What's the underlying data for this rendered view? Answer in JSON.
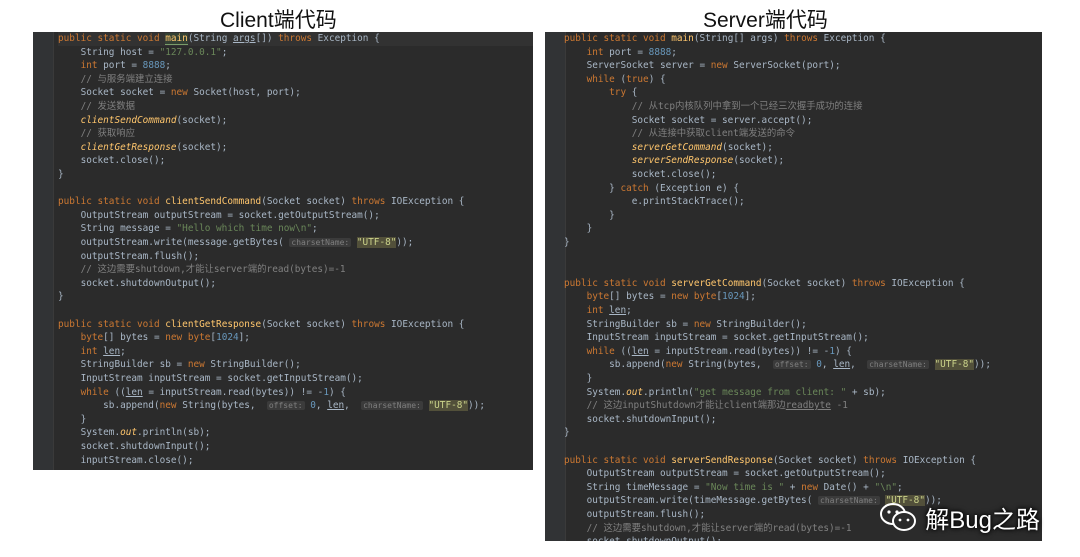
{
  "left_heading": "Client端代码",
  "right_heading": "Server端代码",
  "watermark_text": "解Bug之路",
  "colors": {
    "editor_bg": "#2b2b2b",
    "keyword": "#cc7832",
    "method": "#ffc66d",
    "string": "#6a8759",
    "number": "#6897bb",
    "comment": "#808080",
    "text": "#a9b7c6"
  },
  "client_code": [
    [
      [
        "kw",
        "public static void "
      ],
      [
        "fnm",
        "main"
      ],
      [
        "t",
        "(String "
      ],
      [
        "ul",
        "args"
      ],
      [
        "t",
        "[]) "
      ],
      [
        "kw",
        "throws "
      ],
      [
        "t",
        "Exception {"
      ]
    ],
    [
      [
        "t",
        "    String host = "
      ],
      [
        "str",
        "\"127.0.0.1\""
      ],
      [
        "t",
        ";"
      ]
    ],
    [
      [
        "kw",
        "    int "
      ],
      [
        "t",
        "port = "
      ],
      [
        "num",
        "8888"
      ],
      [
        "t",
        ";"
      ]
    ],
    [
      [
        "cm",
        "    // 与服务端建立连接"
      ]
    ],
    [
      [
        "t",
        "    Socket socket = "
      ],
      [
        "kw",
        "new "
      ],
      [
        "t",
        "Socket(host, port);"
      ]
    ],
    [
      [
        "cm",
        "    // 发送数据"
      ]
    ],
    [
      [
        "t",
        "    "
      ],
      [
        "it",
        "clientSendCommand"
      ],
      [
        "t",
        "(socket);"
      ]
    ],
    [
      [
        "cm",
        "    // 获取响应"
      ]
    ],
    [
      [
        "t",
        "    "
      ],
      [
        "it",
        "clientGetResponse"
      ],
      [
        "t",
        "(socket);"
      ]
    ],
    [
      [
        "t",
        "    socket.close();"
      ]
    ],
    [
      [
        "t",
        "}"
      ]
    ],
    [],
    [
      [
        "kw",
        "public static void "
      ],
      [
        "fn",
        "clientSendCommand"
      ],
      [
        "t",
        "(Socket socket) "
      ],
      [
        "kw",
        "throws "
      ],
      [
        "t",
        "IOException {"
      ]
    ],
    [
      [
        "t",
        "    OutputStream outputStream = socket.getOutputStream();"
      ]
    ],
    [
      [
        "t",
        "    String message = "
      ],
      [
        "str",
        "\"Hello which time now\\n\""
      ],
      [
        "t",
        ";"
      ]
    ],
    [
      [
        "t",
        "    outputStream.write(message.getBytes( "
      ],
      [
        "hint",
        "charsetName:"
      ],
      [
        "t",
        " "
      ],
      [
        "sbox",
        "\"UTF-8\""
      ],
      [
        "t",
        "));"
      ]
    ],
    [
      [
        "t",
        "    outputStream.flush();"
      ]
    ],
    [
      [
        "cm",
        "    // 这边需要shutdown,才能让server端的read(bytes)=-1"
      ]
    ],
    [
      [
        "t",
        "    socket.shutdownOutput();"
      ]
    ],
    [
      [
        "t",
        "}"
      ]
    ],
    [],
    [
      [
        "kw",
        "public static void "
      ],
      [
        "fn",
        "clientGetResponse"
      ],
      [
        "t",
        "(Socket socket) "
      ],
      [
        "kw",
        "throws "
      ],
      [
        "t",
        "IOException {"
      ]
    ],
    [
      [
        "kw",
        "    byte"
      ],
      [
        "t",
        "[] bytes = "
      ],
      [
        "kw",
        "new byte"
      ],
      [
        "t",
        "["
      ],
      [
        "num",
        "1024"
      ],
      [
        "t",
        "];"
      ]
    ],
    [
      [
        "kw",
        "    int "
      ],
      [
        "ul",
        "len"
      ],
      [
        "t",
        ";"
      ]
    ],
    [
      [
        "t",
        "    StringBuilder sb = "
      ],
      [
        "kw",
        "new "
      ],
      [
        "t",
        "StringBuilder();"
      ]
    ],
    [
      [
        "t",
        "    InputStream inputStream = socket.getInputStream();"
      ]
    ],
    [
      [
        "kw",
        "    while "
      ],
      [
        "t",
        "(("
      ],
      [
        "ul",
        "len"
      ],
      [
        "t",
        " = inputStream.read(bytes)) != -"
      ],
      [
        "num",
        "1"
      ],
      [
        "t",
        ") {"
      ]
    ],
    [
      [
        "t",
        "        sb.append("
      ],
      [
        "kw",
        "new "
      ],
      [
        "t",
        "String(bytes,  "
      ],
      [
        "hint",
        "offset:"
      ],
      [
        "t",
        " "
      ],
      [
        "num",
        "0"
      ],
      [
        "t",
        ", "
      ],
      [
        "ul",
        "len"
      ],
      [
        "t",
        ",  "
      ],
      [
        "hint",
        "charsetName:"
      ],
      [
        "t",
        " "
      ],
      [
        "sbox",
        "\"UTF-8\""
      ],
      [
        "t",
        "));"
      ]
    ],
    [
      [
        "t",
        "    }"
      ]
    ],
    [
      [
        "t",
        "    System."
      ],
      [
        "it",
        "out"
      ],
      [
        "t",
        ".println(sb);"
      ]
    ],
    [
      [
        "t",
        "    socket.shutdownInput();"
      ]
    ],
    [
      [
        "t",
        "    inputStream.close();"
      ]
    ]
  ],
  "server_code": [
    [
      [
        "kw",
        "public static void "
      ],
      [
        "fn",
        "main"
      ],
      [
        "t",
        "(String[] args) "
      ],
      [
        "kw",
        "throws "
      ],
      [
        "t",
        "Exception {"
      ]
    ],
    [
      [
        "kw",
        "    int "
      ],
      [
        "t",
        "port = "
      ],
      [
        "num",
        "8888"
      ],
      [
        "t",
        ";"
      ]
    ],
    [
      [
        "t",
        "    ServerSocket server = "
      ],
      [
        "kw",
        "new "
      ],
      [
        "t",
        "ServerSocket(port);"
      ]
    ],
    [
      [
        "kw",
        "    while "
      ],
      [
        "t",
        "("
      ],
      [
        "kw",
        "true"
      ],
      [
        "t",
        ") {"
      ]
    ],
    [
      [
        "kw",
        "        try "
      ],
      [
        "t",
        "{"
      ]
    ],
    [
      [
        "cm",
        "            // 从tcp内核队列中拿到一个已经三次握手成功的连接"
      ]
    ],
    [
      [
        "t",
        "            Socket socket = server.accept();"
      ]
    ],
    [
      [
        "cm",
        "            // 从连接中获取client端发送的命令"
      ]
    ],
    [
      [
        "t",
        "            "
      ],
      [
        "it",
        "serverGetCommand"
      ],
      [
        "t",
        "(socket);"
      ]
    ],
    [
      [
        "t",
        "            "
      ],
      [
        "it",
        "serverSendResponse"
      ],
      [
        "t",
        "(socket);"
      ]
    ],
    [
      [
        "t",
        "            socket.close();"
      ]
    ],
    [
      [
        "t",
        "        } "
      ],
      [
        "kw",
        "catch "
      ],
      [
        "t",
        "(Exception e) {"
      ]
    ],
    [
      [
        "t",
        "            e.printStackTrace();"
      ]
    ],
    [
      [
        "t",
        "        }"
      ]
    ],
    [
      [
        "t",
        "    }"
      ]
    ],
    [
      [
        "t",
        "}"
      ]
    ],
    [],
    [],
    [
      [
        "kw",
        "public static void "
      ],
      [
        "fn",
        "serverGetCommand"
      ],
      [
        "t",
        "(Socket socket) "
      ],
      [
        "kw",
        "throws "
      ],
      [
        "t",
        "IOException {"
      ]
    ],
    [
      [
        "kw",
        "    byte"
      ],
      [
        "t",
        "[] bytes = "
      ],
      [
        "kw",
        "new byte"
      ],
      [
        "t",
        "["
      ],
      [
        "num",
        "1024"
      ],
      [
        "t",
        "];"
      ]
    ],
    [
      [
        "kw",
        "    int "
      ],
      [
        "ul",
        "len"
      ],
      [
        "t",
        ";"
      ]
    ],
    [
      [
        "t",
        "    StringBuilder sb = "
      ],
      [
        "kw",
        "new "
      ],
      [
        "t",
        "StringBuilder();"
      ]
    ],
    [
      [
        "t",
        "    InputStream inputStream = socket.getInputStream();"
      ]
    ],
    [
      [
        "kw",
        "    while "
      ],
      [
        "t",
        "(("
      ],
      [
        "ul",
        "len"
      ],
      [
        "t",
        " = inputStream.read(bytes)) != -"
      ],
      [
        "num",
        "1"
      ],
      [
        "t",
        ") {"
      ]
    ],
    [
      [
        "t",
        "        sb.append("
      ],
      [
        "kw",
        "new "
      ],
      [
        "t",
        "String(bytes,  "
      ],
      [
        "hint",
        "offset:"
      ],
      [
        "t",
        " "
      ],
      [
        "num",
        "0"
      ],
      [
        "t",
        ", "
      ],
      [
        "ul",
        "len"
      ],
      [
        "t",
        ",  "
      ],
      [
        "hint",
        "charsetName:"
      ],
      [
        "t",
        " "
      ],
      [
        "sbox",
        "\"UTF-8\""
      ],
      [
        "t",
        "));"
      ]
    ],
    [
      [
        "t",
        "    }"
      ]
    ],
    [
      [
        "t",
        "    System."
      ],
      [
        "it",
        "out"
      ],
      [
        "t",
        ".println("
      ],
      [
        "str",
        "\"get message from client: \""
      ],
      [
        "t",
        " + sb);"
      ]
    ],
    [
      [
        "cm",
        "    // 这边inputShutdown才能让client端那边"
      ],
      [
        "cmul",
        "readbyte"
      ],
      [
        "cm",
        " -1"
      ]
    ],
    [
      [
        "t",
        "    socket.shutdownInput();"
      ]
    ],
    [
      [
        "t",
        "}"
      ]
    ],
    [],
    [
      [
        "kw",
        "public static void "
      ],
      [
        "fn",
        "serverSendResponse"
      ],
      [
        "t",
        "(Socket socket) "
      ],
      [
        "kw",
        "throws "
      ],
      [
        "t",
        "IOException {"
      ]
    ],
    [
      [
        "t",
        "    OutputStream outputStream = socket.getOutputStream();"
      ]
    ],
    [
      [
        "t",
        "    String timeMessage = "
      ],
      [
        "str",
        "\"Now time is \""
      ],
      [
        "t",
        " + "
      ],
      [
        "kw",
        "new "
      ],
      [
        "t",
        "Date() + "
      ],
      [
        "str",
        "\"\\n\""
      ],
      [
        "t",
        ";"
      ]
    ],
    [
      [
        "t",
        "    outputStream.write(timeMessage.getBytes( "
      ],
      [
        "hint",
        "charsetName:"
      ],
      [
        "t",
        " "
      ],
      [
        "sbox",
        "\"UTF-8\""
      ],
      [
        "t",
        "));"
      ]
    ],
    [
      [
        "t",
        "    outputStream.flush();"
      ]
    ],
    [
      [
        "cm",
        "    // 这边需要shutdown,才能让server端的read(bytes)=-1"
      ]
    ],
    [
      [
        "t",
        "    socket.shutdownOutput();"
      ]
    ]
  ]
}
